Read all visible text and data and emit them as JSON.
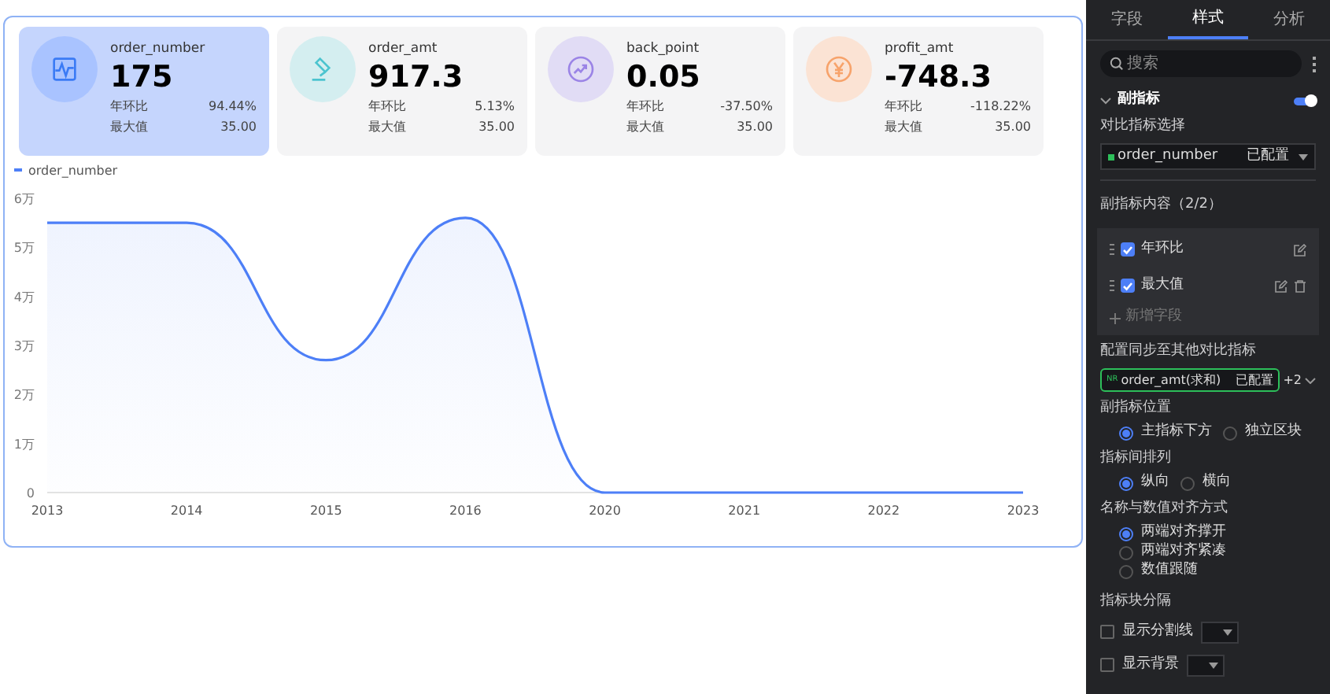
{
  "cards": [
    {
      "kind": "wave",
      "name": "order_number",
      "value": "175",
      "selected": true,
      "rows": [
        {
          "label": "年环比",
          "value": "94.44%"
        },
        {
          "label": "最大值",
          "value": "35.00"
        }
      ]
    },
    {
      "kind": "gavel",
      "name": "order_amt",
      "value": "917.3",
      "selected": false,
      "rows": [
        {
          "label": "年环比",
          "value": "5.13%"
        },
        {
          "label": "最大值",
          "value": "35.00"
        }
      ]
    },
    {
      "kind": "trend",
      "name": "back_point",
      "value": "0.05",
      "selected": false,
      "rows": [
        {
          "label": "年环比",
          "value": "-37.50%"
        },
        {
          "label": "最大值",
          "value": "35.00"
        }
      ]
    },
    {
      "kind": "yen",
      "name": "profit_amt",
      "value": "-748.3",
      "selected": false,
      "rows": [
        {
          "label": "年环比",
          "value": "-118.22%"
        },
        {
          "label": "最大值",
          "value": "35.00"
        }
      ]
    }
  ],
  "chart": {
    "chart_data": {
      "type": "area",
      "categories": [
        "2013",
        "2014",
        "2015",
        "2016",
        "2020",
        "2021",
        "2022",
        "2023"
      ],
      "series": [
        {
          "name": "order_number",
          "color": "#4d7ff7",
          "values": [
            5.5,
            5.5,
            2.7,
            5.6,
            0,
            0,
            0,
            0
          ]
        }
      ],
      "ylim": [
        0,
        6
      ],
      "yticks": [
        {
          "value": 0,
          "label": "0"
        },
        {
          "value": 1,
          "label": "1万"
        },
        {
          "value": 2,
          "label": "2万"
        },
        {
          "value": 3,
          "label": "3万"
        },
        {
          "value": 4,
          "label": "4万"
        },
        {
          "value": 5,
          "label": "5万"
        },
        {
          "value": 6,
          "label": "6万"
        }
      ]
    }
  },
  "panel": {
    "tabs": [
      {
        "label": "字段",
        "selected": false
      },
      {
        "label": "样式",
        "selected": true
      },
      {
        "label": "分析",
        "selected": false
      }
    ],
    "search": {
      "placeholder": "搜索"
    },
    "section": {
      "title": "副指标",
      "expanded": true,
      "on": true
    },
    "compare_label": "对比指标选择",
    "compare_select": {
      "value": "order_number",
      "status": "已配置"
    },
    "content_label": "副指标内容（2/2）",
    "content_items": [
      {
        "label": "年环比",
        "checked": true,
        "deletable": false
      },
      {
        "label": "最大值",
        "checked": true,
        "deletable": true
      }
    ],
    "add_field": "新增字段",
    "sync_label": "配置同步至其他对比指标",
    "sync_select": {
      "badge": "NR",
      "value": "order_amt(求和)",
      "status": "已配置",
      "extra": "+2"
    },
    "radio_groups": [
      {
        "label": "副指标位置",
        "options": [
          {
            "label": "主指标下方",
            "selected": true
          },
          {
            "label": "独立区块",
            "selected": false
          }
        ]
      },
      {
        "label": "指标间排列",
        "options": [
          {
            "label": "纵向",
            "selected": true
          },
          {
            "label": "横向",
            "selected": false
          }
        ]
      },
      {
        "label": "名称与数值对齐方式",
        "options": [
          {
            "label": "两端对齐撑开",
            "selected": true
          },
          {
            "label": "两端对齐紧凑",
            "selected": false
          },
          {
            "label": "数值跟随",
            "selected": false
          }
        ]
      }
    ],
    "divider_label": "指标块分隔",
    "divider_options": [
      {
        "label": "显示分割线",
        "checked": false
      },
      {
        "label": "显示背景",
        "checked": false
      }
    ]
  }
}
